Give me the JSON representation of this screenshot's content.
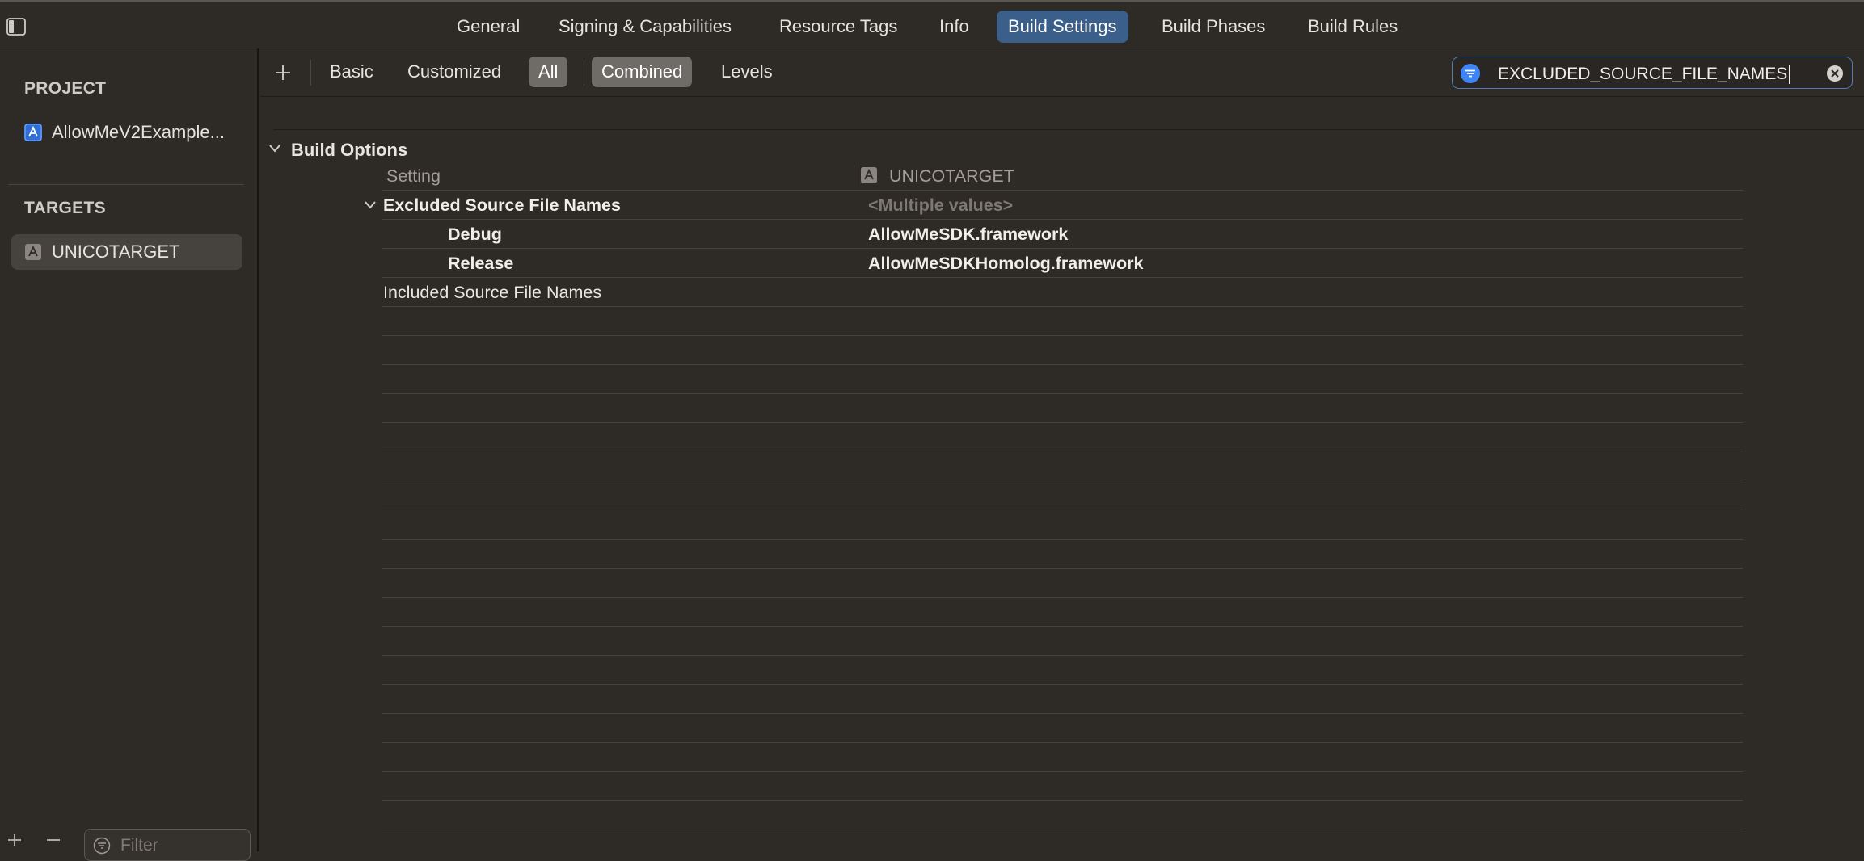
{
  "tabs": [
    {
      "label": "General",
      "selected": false
    },
    {
      "label": "Signing & Capabilities",
      "selected": false
    },
    {
      "label": "Resource Tags",
      "selected": false
    },
    {
      "label": "Info",
      "selected": false
    },
    {
      "label": "Build Settings",
      "selected": true
    },
    {
      "label": "Build Phases",
      "selected": false
    },
    {
      "label": "Build Rules",
      "selected": false
    }
  ],
  "sidebar": {
    "project_heading": "PROJECT",
    "project_item": "AllowMeV2Example...",
    "targets_heading": "TARGETS",
    "target_item": "UNICOTARGET",
    "filter_placeholder": "Filter"
  },
  "toolbar": {
    "add_label": "+",
    "basic": "Basic",
    "customized": "Customized",
    "all": "All",
    "combined": "Combined",
    "levels": "Levels",
    "selected_scope": "All",
    "selected_view": "Combined"
  },
  "search": {
    "value": "EXCLUDED_SOURCE_FILE_NAMES"
  },
  "settings": {
    "group_title": "Build Options",
    "column_setting": "Setting",
    "column_target": "UNICOTARGET",
    "rows": [
      {
        "name": "Excluded Source File Names",
        "value": "<Multiple values>"
      },
      {
        "name": "Debug",
        "value": "AllowMeSDK.framework"
      },
      {
        "name": "Release",
        "value": "AllowMeSDKHomolog.framework"
      },
      {
        "name": "Included Source File Names",
        "value": ""
      }
    ]
  },
  "colors": {
    "accent": "#3a5f8a",
    "background": "#2e2a26",
    "search_icon": "#3d84f6"
  }
}
